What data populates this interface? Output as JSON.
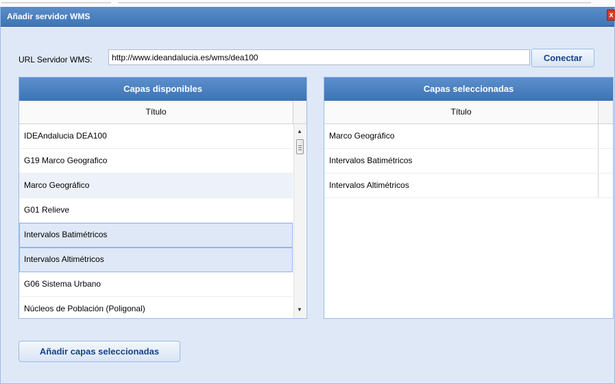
{
  "dialog": {
    "title": "Añadir servidor WMS",
    "close_label": "x"
  },
  "url": {
    "label": "URL Servidor WMS:",
    "value": "http://www.ideandalucia.es/wms/dea100",
    "connect_label": "Conectar"
  },
  "available": {
    "header": "Capas disponibles",
    "column_title": "Título",
    "rows": [
      {
        "label": "IDEAndalucia DEA100",
        "state": "normal"
      },
      {
        "label": "G19 Marco Geografico",
        "state": "normal"
      },
      {
        "label": "Marco Geográfico",
        "state": "alt"
      },
      {
        "label": "G01 Relieve",
        "state": "normal"
      },
      {
        "label": "Intervalos Batimétricos",
        "state": "selected"
      },
      {
        "label": "Intervalos Altimétricos",
        "state": "selected"
      },
      {
        "label": "G06 Sistema Urbano",
        "state": "normal"
      },
      {
        "label": "Núcleos de Población (Poligonal)",
        "state": "normal"
      }
    ]
  },
  "selected": {
    "header": "Capas seleccionadas",
    "column_title": "Título",
    "rows": [
      {
        "label": "Marco Geográfico"
      },
      {
        "label": "Intervalos Batimétricos"
      },
      {
        "label": "Intervalos Altimétricos"
      }
    ]
  },
  "actions": {
    "add_label": "Añadir capas seleccionadas"
  },
  "colors": {
    "title_bar": "#3f75b7",
    "panel_bg": "#dfe8f6",
    "button_text": "#15428b",
    "selection_border": "#8fb5e6"
  }
}
